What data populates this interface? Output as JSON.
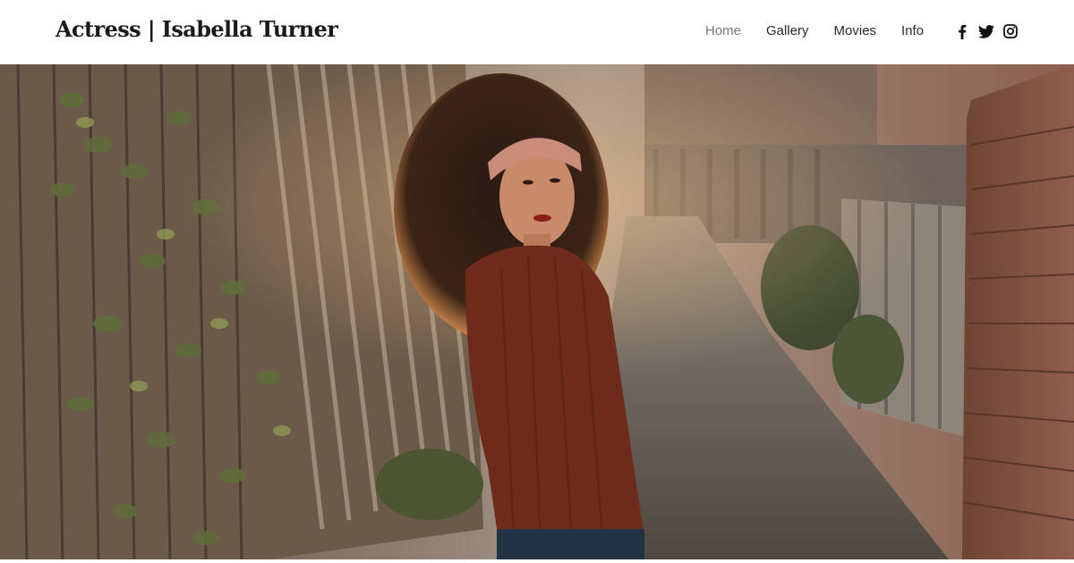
{
  "site": {
    "title": "Actress | Isabella Turner"
  },
  "nav": {
    "items": [
      {
        "label": "Home",
        "active": true
      },
      {
        "label": "Gallery",
        "active": false
      },
      {
        "label": "Movies",
        "active": false
      },
      {
        "label": "Info",
        "active": false
      }
    ]
  },
  "social": {
    "icons": [
      "facebook-icon",
      "twitter-icon",
      "instagram-icon"
    ]
  },
  "hero": {
    "image": "hero-photo"
  },
  "colors": {
    "text": "#1a1a1a",
    "nav_active": "#777777",
    "background": "#ffffff"
  }
}
